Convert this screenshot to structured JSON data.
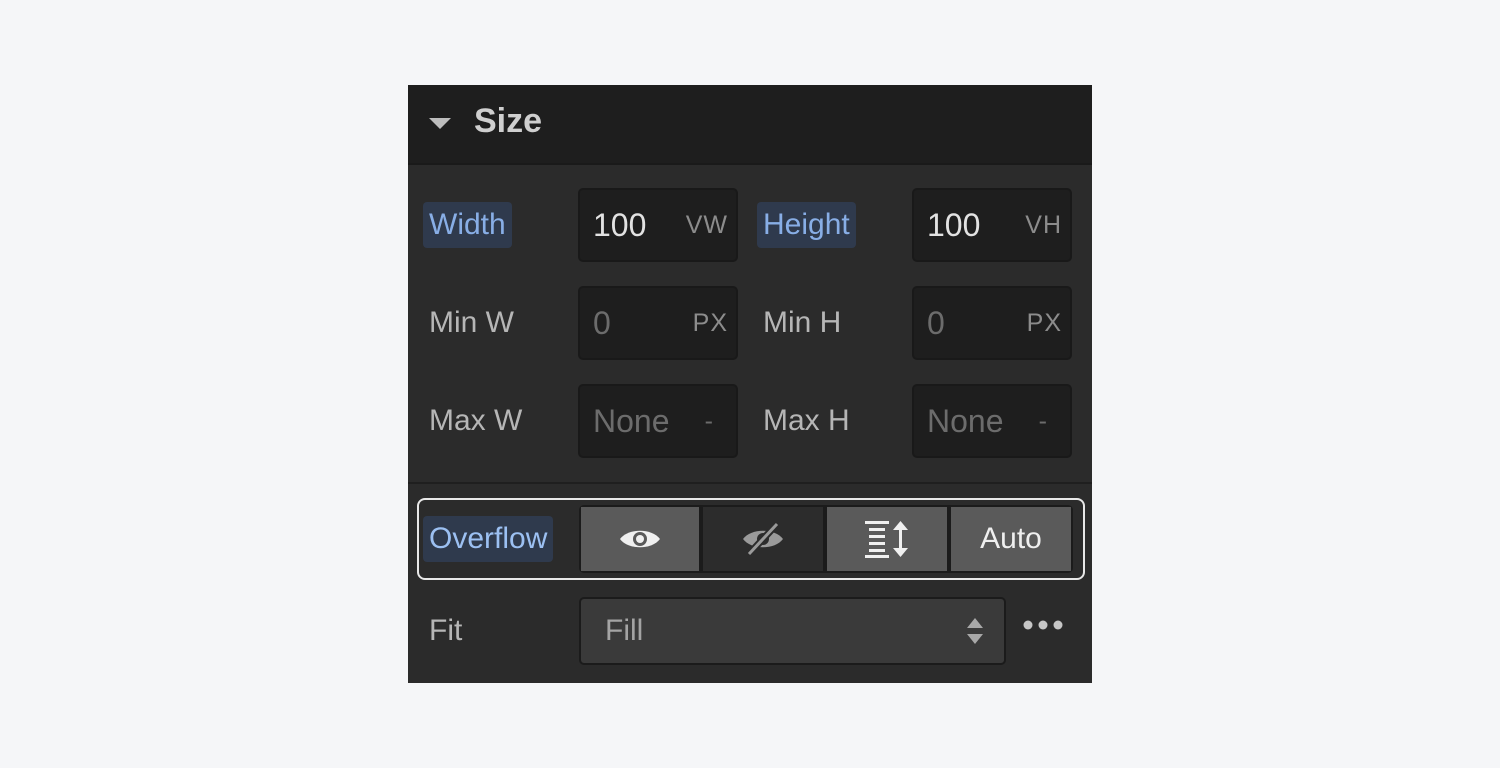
{
  "section": {
    "title": "Size"
  },
  "width": {
    "label": "Width",
    "value": "100",
    "unit": "VW"
  },
  "height": {
    "label": "Height",
    "value": "100",
    "unit": "VH"
  },
  "min_w": {
    "label": "Min W",
    "value": "0",
    "unit": "PX"
  },
  "min_h": {
    "label": "Min H",
    "value": "0",
    "unit": "PX"
  },
  "max_w": {
    "label": "Max W",
    "value": "None",
    "unit": "-"
  },
  "max_h": {
    "label": "Max H",
    "value": "None",
    "unit": "-"
  },
  "overflow": {
    "label": "Overflow",
    "options": [
      {
        "icon": "eye-icon",
        "tooltip_name": "visible",
        "selected": true
      },
      {
        "icon": "eye-slash-icon",
        "tooltip_name": "hidden",
        "selected": false
      },
      {
        "icon": "scroll-icon",
        "tooltip_name": "scroll",
        "selected": true
      },
      {
        "label": "Auto",
        "selected": true
      }
    ]
  },
  "fit": {
    "label": "Fit",
    "value": "Fill"
  },
  "colors": {
    "panel_bg": "#2b2b2b",
    "header_bg": "#1e1e1e",
    "active_label_bg": "#2f3a4d",
    "active_label_text": "#88aee6",
    "highlight_outline": "#e8e8e8"
  }
}
